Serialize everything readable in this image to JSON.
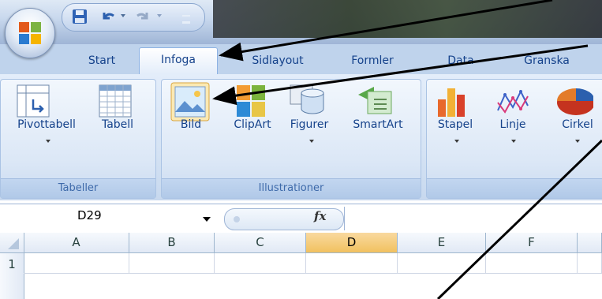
{
  "tabs": [
    "Start",
    "Infoga",
    "Sidlayout",
    "Formler",
    "Data",
    "Granska"
  ],
  "active_tab": "Infoga",
  "groups": {
    "tables": {
      "label": "Tabeller",
      "buttons": [
        "Pivottabell",
        "Tabell"
      ]
    },
    "illustrations": {
      "label": "Illustrationer",
      "buttons": [
        "Bild",
        "ClipArt",
        "Figurer",
        "SmartArt"
      ]
    },
    "charts": {
      "buttons": [
        "Stapel",
        "Linje",
        "Cirkel"
      ]
    }
  },
  "name_box": "D29",
  "fx_label": "fx",
  "columns": [
    "A",
    "B",
    "C",
    "D",
    "E",
    "F"
  ],
  "selected_column": "D",
  "rows": [
    "1"
  ],
  "colors": {
    "accent": "#15428b",
    "ribbon": "#dbe7f6",
    "selected_header": "#f1c15f",
    "annotation_arrow": "#000000"
  }
}
